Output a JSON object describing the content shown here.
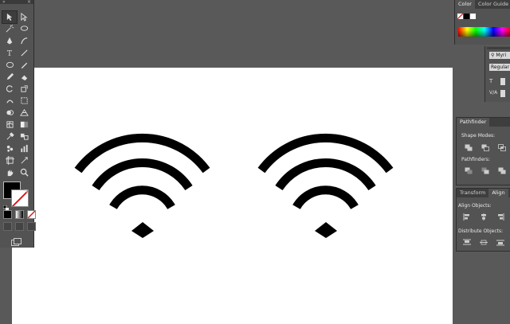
{
  "toolbar": {
    "collapse_glyph": "»",
    "close_glyph": "×",
    "tools": [
      {
        "name": "selection-tool-icon"
      },
      {
        "name": "direct-selection-tool-icon"
      },
      {
        "name": "magic-wand-tool-icon"
      },
      {
        "name": "lasso-tool-icon"
      },
      {
        "name": "pen-tool-icon"
      },
      {
        "name": "curvature-tool-icon"
      },
      {
        "name": "type-tool-icon"
      },
      {
        "name": "line-segment-tool-icon"
      },
      {
        "name": "ellipse-tool-icon"
      },
      {
        "name": "paintbrush-tool-icon"
      },
      {
        "name": "pencil-tool-icon"
      },
      {
        "name": "eraser-tool-icon"
      },
      {
        "name": "rotate-tool-icon"
      },
      {
        "name": "scale-tool-icon"
      },
      {
        "name": "warp-tool-icon"
      },
      {
        "name": "free-transform-tool-icon"
      },
      {
        "name": "shape-builder-tool-icon"
      },
      {
        "name": "perspective-grid-tool-icon"
      },
      {
        "name": "mesh-tool-icon"
      },
      {
        "name": "gradient-tool-icon"
      },
      {
        "name": "eyedropper-tool-icon"
      },
      {
        "name": "blend-tool-icon"
      },
      {
        "name": "symbol-sprayer-tool-icon"
      },
      {
        "name": "column-graph-tool-icon"
      },
      {
        "name": "artboard-tool-icon"
      },
      {
        "name": "slice-tool-icon"
      },
      {
        "name": "hand-tool-icon"
      },
      {
        "name": "zoom-tool-icon"
      }
    ]
  },
  "color_panel": {
    "tabs": [
      "Color",
      "Color Guide"
    ]
  },
  "character_panel": {
    "font_search": "Myri",
    "font_style": "Regular"
  },
  "pathfinder_panel": {
    "tab": "Pathfinder",
    "shape_modes_label": "Shape Modes:",
    "pathfinders_label": "Pathfinders:"
  },
  "align_panel": {
    "tabs": [
      "Transform",
      "Align"
    ],
    "align_objects_label": "Align Objects:",
    "distribute_objects_label": "Distribute Objects:"
  },
  "colors": {
    "workspace": "#595959",
    "panel": "#535353",
    "artboard": "#ffffff",
    "artwork": "#000000"
  }
}
